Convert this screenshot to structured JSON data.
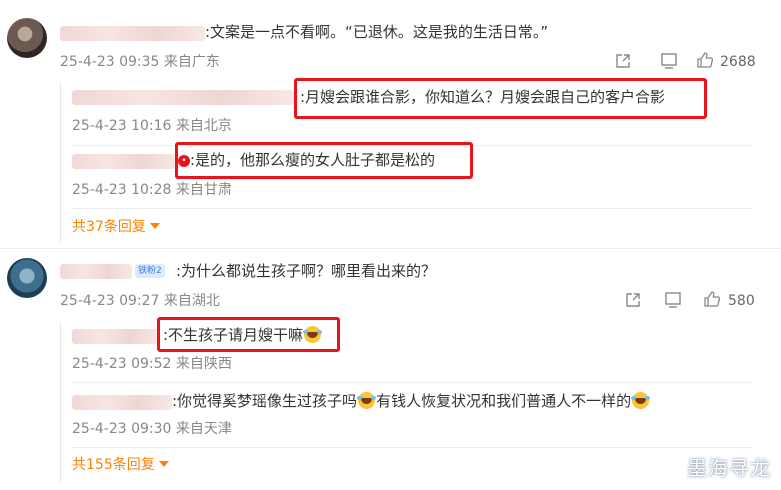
{
  "comments": [
    {
      "text": ":文案是一点不看啊。“已退休。这是我的生活日常。”",
      "time": "25-4-23 09:35",
      "location": "来自广东",
      "like_count": "2688",
      "replies": [
        {
          "text": ":月嫂会跟谁合影，你知道么？月嫂会跟自己的客户合影",
          "time": "25-4-23 10:16",
          "location": "来自北京"
        },
        {
          "text": ":是的，他那么瘦的女人肚子都是松的",
          "time": "25-4-23 10:28",
          "location": "来自甘肃"
        }
      ],
      "more_replies": "共37条回复"
    },
    {
      "badge": "铁粉2",
      "text": ":为什么都说生孩子啊？哪里看出来的？",
      "time": "25-4-23 09:27",
      "location": "来自湖北",
      "like_count": "580",
      "replies": [
        {
          "text": ":不生孩子请月嫂干嘛",
          "time": "25-4-23 09:52",
          "location": "来自陕西"
        },
        {
          "text_a": ":你觉得奚梦瑶像生过孩子吗",
          "text_b": "有钱人恢复状况和我们普通人不一样的",
          "time": "25-4-23 09:30",
          "location": "来自天津"
        }
      ],
      "more_replies": "共155条回复"
    }
  ],
  "watermark": "墨海寻龙",
  "colors": {
    "highlight_box": "#e8141b",
    "more_link": "#ff8200",
    "meta": "#888888"
  },
  "icons": [
    "share-icon",
    "comment-icon",
    "like-icon",
    "chevron-down-icon",
    "laughing-tears-emoji-icon"
  ]
}
